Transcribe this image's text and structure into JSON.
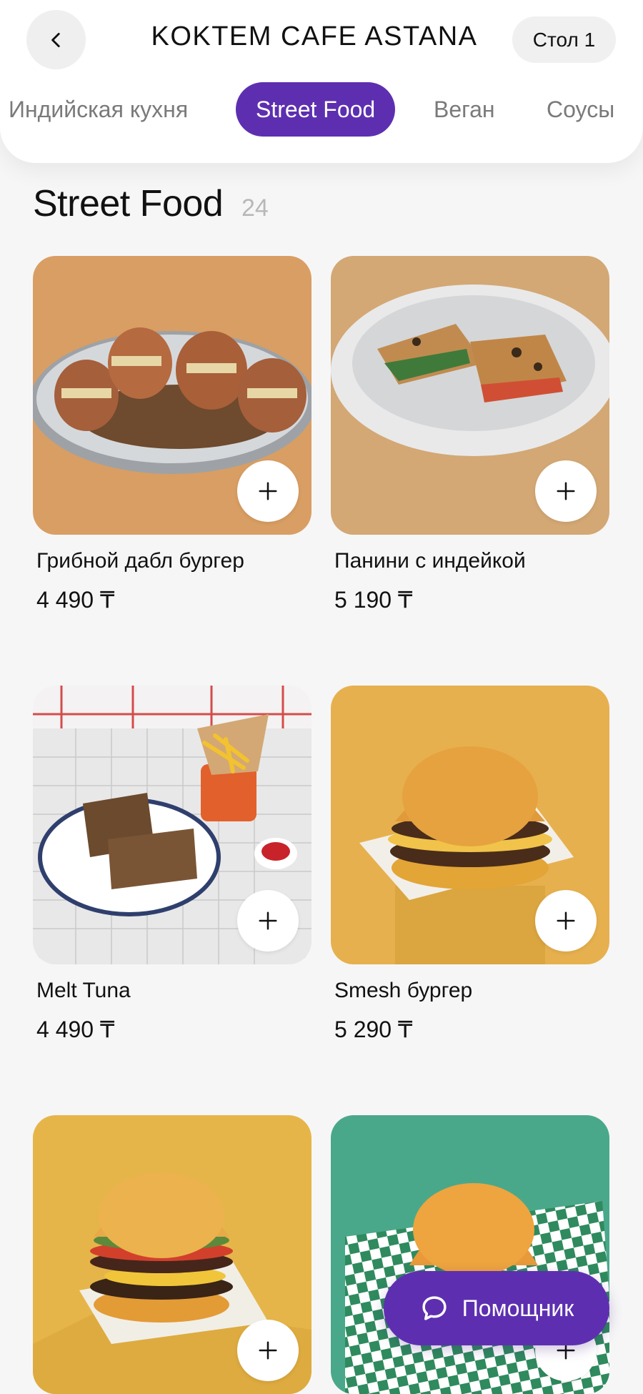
{
  "header": {
    "title": "KOKTEM CAFE ASTANA",
    "table_label": "Стол 1"
  },
  "tabs": [
    {
      "label": "Индийская кухня",
      "active": false
    },
    {
      "label": "Street Food",
      "active": true
    },
    {
      "label": "Веган",
      "active": false
    },
    {
      "label": "Соусы",
      "active": false
    }
  ],
  "section": {
    "title": "Street Food",
    "count": "24"
  },
  "products": [
    {
      "name": "Грибной дабл бургер",
      "price": "4 490 ₸",
      "image": "mushroom-double-burger-photo"
    },
    {
      "name": "Панини с индейкой",
      "price": "5 190 ₸",
      "image": "turkey-panini-photo"
    },
    {
      "name": "Melt Tuna",
      "price": "4 490 ₸",
      "image": "melt-tuna-photo"
    },
    {
      "name": "Smesh бургер",
      "price": "5 290 ₸",
      "image": "smesh-burger-photo"
    },
    {
      "name": "",
      "price": "",
      "image": "burger-photo"
    },
    {
      "name": "",
      "price": "",
      "image": "burger-green-photo"
    }
  ],
  "assistant": {
    "label": "Помощник",
    "icon": "chat-bubble-icon"
  },
  "colors": {
    "accent": "#5d2fb0",
    "background": "#f6f6f7"
  }
}
